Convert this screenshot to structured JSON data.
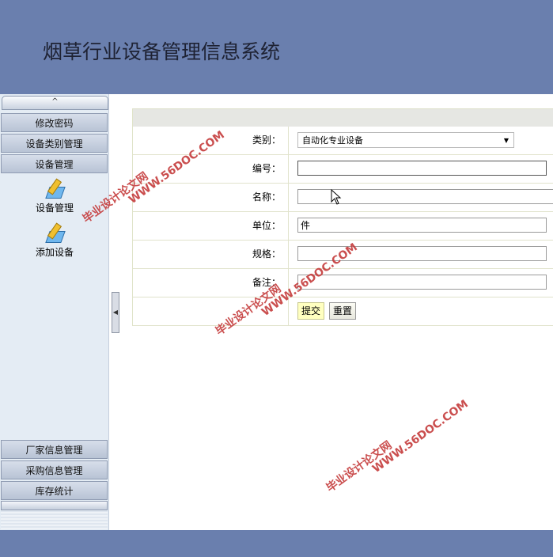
{
  "app": {
    "title": "烟草行业设备管理信息系统"
  },
  "sidebar": {
    "top_handle": "^",
    "menu_top": [
      "修改密码",
      "设备类别管理",
      "设备管理"
    ],
    "submenu": [
      "设备管理",
      "添加设备"
    ],
    "menu_bottom": [
      "厂家信息管理",
      "采购信息管理",
      "库存统计"
    ]
  },
  "form": {
    "category_label": "类别：",
    "category_value": "自动化专业设备",
    "code_label": "编号：",
    "code_value": "",
    "name_label": "名称：",
    "name_value": "",
    "unit_label": "单位：",
    "unit_value": "件",
    "spec_label": "规格：",
    "spec_value": "",
    "note_label": "备注：",
    "note_value": "",
    "submit_label": "提交",
    "reset_label": "重置"
  },
  "watermarks": {
    "url": "WWW.56DOC.COM",
    "cn": "毕业设计论文网"
  },
  "colors": {
    "header": "#6a7fae",
    "sidebar": "#e4ecf4",
    "submit_bg": "#ffffc0",
    "watermark": "#c53b3b"
  },
  "icons": [
    "edit-icon",
    "chevron-down-icon",
    "collapse-arrow-icon",
    "mouse-cursor-icon"
  ]
}
